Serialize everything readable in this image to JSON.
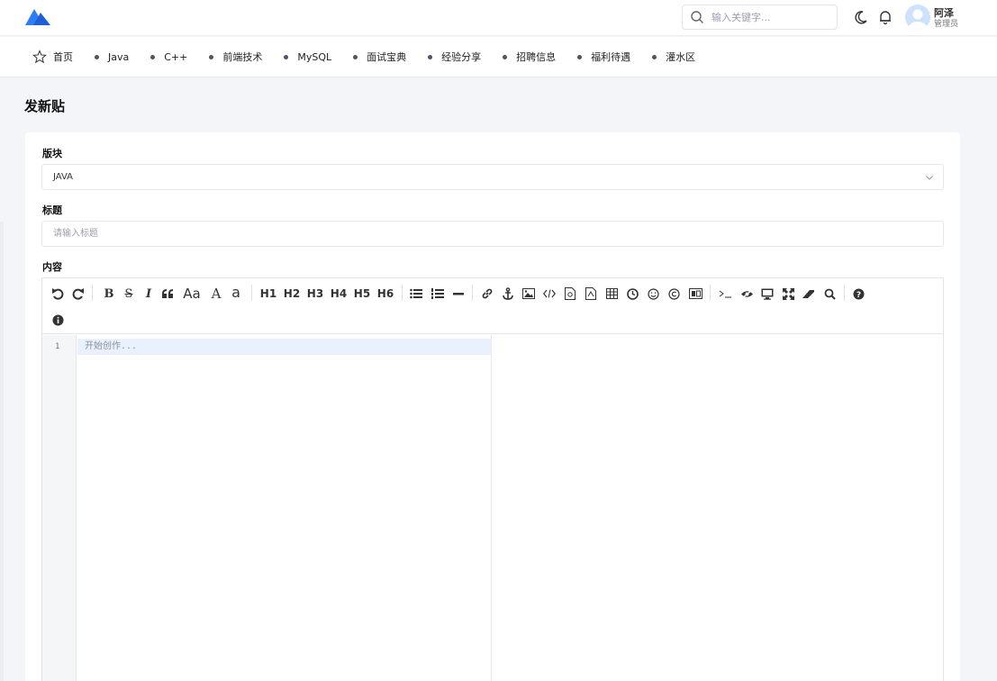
{
  "header": {
    "search_placeholder": "输入关键字...",
    "user": {
      "name": "阿泽",
      "role": "管理员"
    },
    "icons": [
      "logo-icon",
      "search-icon",
      "moon-icon",
      "bell-icon",
      "avatar-icon"
    ],
    "brand_color": "#2f7cf6"
  },
  "nav": {
    "items": [
      {
        "label": "首页",
        "icon": "star-icon"
      },
      {
        "label": "Java"
      },
      {
        "label": "C++"
      },
      {
        "label": "前端技术"
      },
      {
        "label": "MySQL"
      },
      {
        "label": "面试宝典"
      },
      {
        "label": "经验分享"
      },
      {
        "label": "招聘信息"
      },
      {
        "label": "福利待遇"
      },
      {
        "label": "灌水区"
      }
    ]
  },
  "page": {
    "title": "发新贴"
  },
  "form": {
    "section_label": "版块",
    "section_value": "JAVA",
    "title_label": "标题",
    "title_placeholder": "请输入标题",
    "content_label": "内容"
  },
  "editor": {
    "toolbar": {
      "text_buttons": [
        "B",
        "S",
        "I",
        "Aa",
        "A",
        "a",
        "H1",
        "H2",
        "H3",
        "H4",
        "H5",
        "H6"
      ],
      "icons": [
        "undo-icon",
        "redo-icon",
        "bold-icon",
        "strikethrough-icon",
        "italic-icon",
        "quote-icon",
        "uppercase-icon",
        "capitalize-icon",
        "lowercase-icon",
        "h1-icon",
        "h2-icon",
        "h3-icon",
        "h4-icon",
        "h5-icon",
        "h6-icon",
        "unordered-list-icon",
        "ordered-list-icon",
        "horizontal-rule-icon",
        "link-icon",
        "anchor-icon",
        "image-icon",
        "code-icon",
        "code-block-icon",
        "preformatted-icon",
        "table-icon",
        "datetime-icon",
        "emoji-icon",
        "html-entities-icon",
        "pagebreak-icon",
        "terminal-icon",
        "watch-icon",
        "preview-icon",
        "fullscreen-icon",
        "clear-icon",
        "search-icon",
        "help-icon",
        "info-icon"
      ]
    },
    "line_number": "1",
    "placeholder": "开始创作..."
  }
}
